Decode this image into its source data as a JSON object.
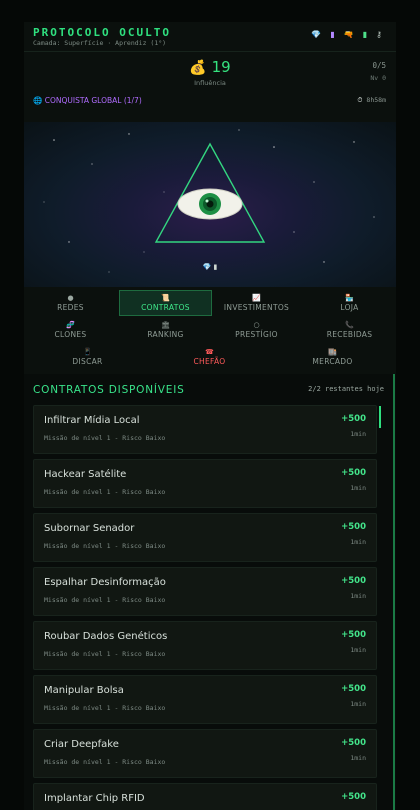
{
  "header": {
    "title": "PROTOCOLO OCULTO",
    "subtitle": "Camada: Superfície · Aprendiz (1°)",
    "icons": [
      "gem-icon",
      "vial-icon",
      "gun-icon",
      "battery-icon",
      "key-icon"
    ]
  },
  "stats": {
    "money_icon": "money-bag-icon",
    "influence_value": "19",
    "influence_label": "Influência",
    "counter": "0/5",
    "level": "Nv 0"
  },
  "conquest": {
    "label": "CONQUISTA GLOBAL (1/7)",
    "timer": "8h58m"
  },
  "hero": {
    "image": "all-seeing-eye-triangle",
    "badges": "💎 ▮"
  },
  "nav": {
    "items": [
      {
        "icon": "●",
        "label": "REDES"
      },
      {
        "icon": "📜",
        "label": "CONTRATOS",
        "active": true
      },
      {
        "icon": "📈",
        "label": "INVESTIMENTOS"
      },
      {
        "icon": "🏪",
        "label": "LOJA"
      },
      {
        "icon": "🧬",
        "label": "CLONES"
      },
      {
        "icon": "🏛",
        "label": "RANKING"
      },
      {
        "icon": "○",
        "label": "PRESTÍGIO"
      },
      {
        "icon": "📞",
        "label": "RECEBIDAS"
      },
      {
        "icon": "📱",
        "label": "DISCAR"
      },
      {
        "icon": "☎",
        "label": "CHEFÃO"
      },
      {
        "icon": "🏬",
        "label": "MERCADO"
      }
    ]
  },
  "contracts": {
    "title": "CONTRATOS DISPONÍVEIS",
    "remaining": "2/2 restantes hoje",
    "items": [
      {
        "title": "Infiltrar Mídia Local",
        "sub": "Missão de nível 1 - Risco Baixo",
        "reward": "+500",
        "time": "1min"
      },
      {
        "title": "Hackear Satélite",
        "sub": "Missão de nível 1 - Risco Baixo",
        "reward": "+500",
        "time": "1min"
      },
      {
        "title": "Subornar Senador",
        "sub": "Missão de nível 1 - Risco Baixo",
        "reward": "+500",
        "time": "1min"
      },
      {
        "title": "Espalhar Desinformação",
        "sub": "Missão de nível 1 - Risco Baixo",
        "reward": "+500",
        "time": "1min"
      },
      {
        "title": "Roubar Dados Genéticos",
        "sub": "Missão de nível 1 - Risco Baixo",
        "reward": "+500",
        "time": "1min"
      },
      {
        "title": "Manipular Bolsa",
        "sub": "Missão de nível 1 - Risco Baixo",
        "reward": "+500",
        "time": "1min"
      },
      {
        "title": "Criar Deepfake",
        "sub": "Missão de nível 1 - Risco Baixo",
        "reward": "+500",
        "time": "1min"
      },
      {
        "title": "Implantar Chip RFID",
        "sub": "",
        "reward": "+500",
        "time": ""
      }
    ]
  }
}
